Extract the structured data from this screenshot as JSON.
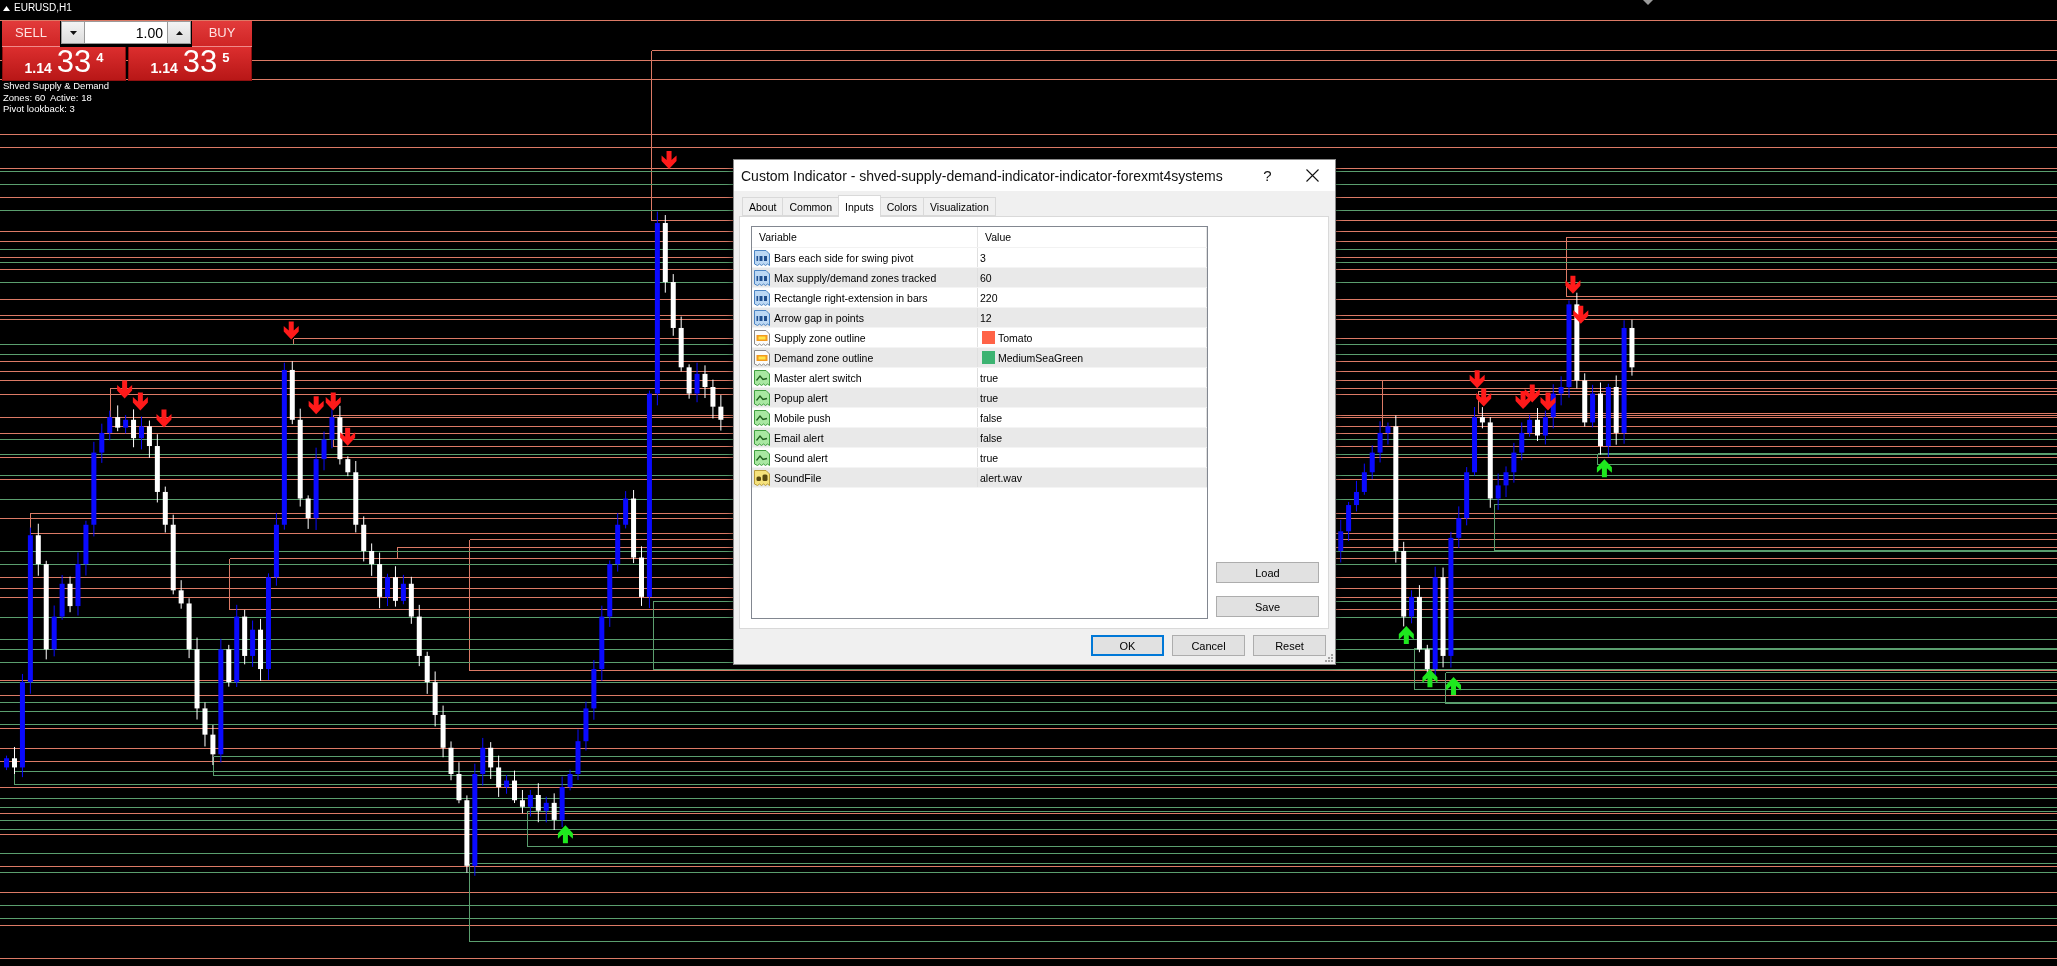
{
  "chart": {
    "symbol": "EURUSD,H1"
  },
  "trade_panel": {
    "sell": {
      "label": "SELL",
      "price_prefix": "1.14",
      "price_main": "33",
      "price_pip": "4"
    },
    "lot": "1.00",
    "buy": {
      "label": "BUY",
      "price_prefix": "1.14",
      "price_main": "33",
      "price_pip": "5"
    }
  },
  "indicator_info": [
    "Shved Supply & Demand",
    "Zones: 60  Active: 18",
    "Pivot lookback: 3"
  ],
  "dialog": {
    "title": "Custom Indicator - shved-supply-demand-indicator-indicator-forexmt4systems",
    "help": "?",
    "tabs": [
      {
        "label": "About",
        "selected": false
      },
      {
        "label": "Common",
        "selected": false
      },
      {
        "label": "Inputs",
        "selected": true
      },
      {
        "label": "Colors",
        "selected": false
      },
      {
        "label": "Visualization",
        "selected": false
      }
    ],
    "table": {
      "columns": [
        "Variable",
        "Value"
      ],
      "rows": [
        {
          "kind": "int",
          "variable": "Bars each side for swing pivot",
          "value": "3"
        },
        {
          "kind": "int",
          "variable": "Max supply/demand zones tracked",
          "value": "60"
        },
        {
          "kind": "int",
          "variable": "Rectangle right-extension in bars",
          "value": "220"
        },
        {
          "kind": "int",
          "variable": "Arrow gap in points",
          "value": "12"
        },
        {
          "kind": "color",
          "variable": "Supply zone outline",
          "value": "Tomato",
          "color": "#ff6347"
        },
        {
          "kind": "color",
          "variable": "Demand zone outline",
          "value": "MediumSeaGreen",
          "color": "#3cb371"
        },
        {
          "kind": "bool",
          "variable": "Master alert switch",
          "value": "true"
        },
        {
          "kind": "bool",
          "variable": "Popup alert",
          "value": "true"
        },
        {
          "kind": "bool",
          "variable": "Mobile push",
          "value": "false"
        },
        {
          "kind": "bool",
          "variable": "Email alert",
          "value": "false"
        },
        {
          "kind": "bool",
          "variable": "Sound alert",
          "value": "true"
        },
        {
          "kind": "string",
          "variable": "SoundFile",
          "value": "alert.wav"
        }
      ]
    },
    "side_buttons": [
      "Load",
      "Save"
    ],
    "buttons": [
      {
        "label": "OK",
        "default": true
      },
      {
        "label": "Cancel",
        "default": false
      },
      {
        "label": "Reset",
        "default": false
      }
    ]
  }
}
